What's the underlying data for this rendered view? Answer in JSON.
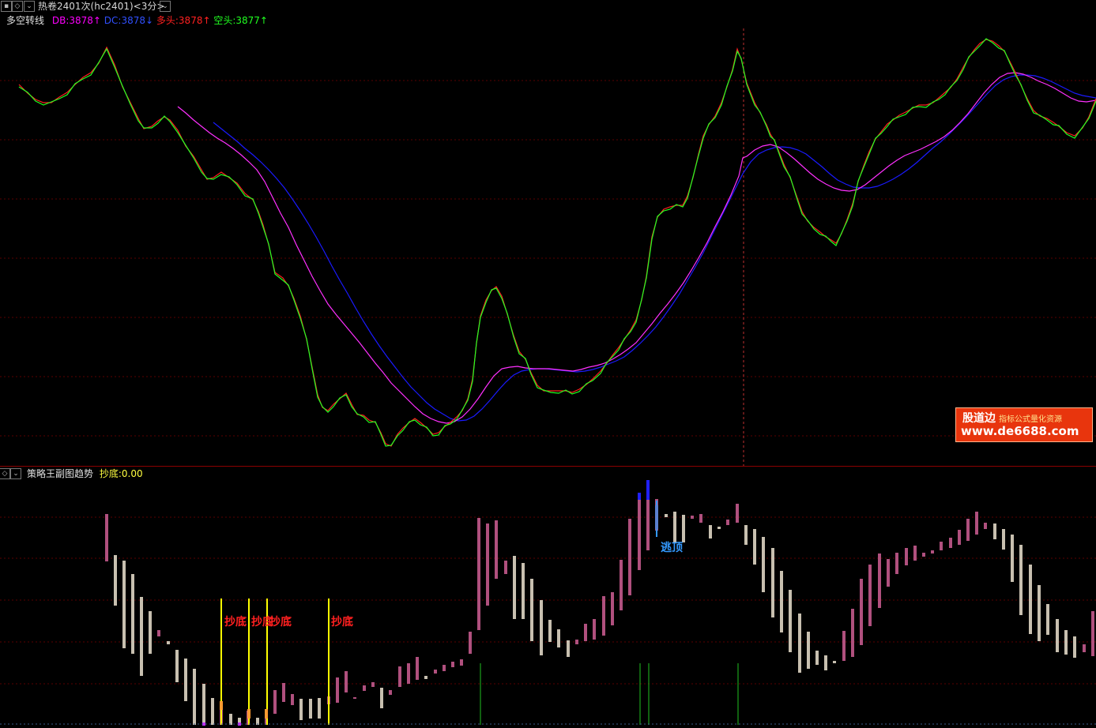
{
  "header": {
    "title": "热卷2401次(hc2401)<3分>"
  },
  "main_legend": {
    "name": "多空转线",
    "db": "DB:3878↑",
    "dc": "DC:3878↓",
    "duotou": "多头:3878↑",
    "kongtou": "空头:3877↑"
  },
  "sub_legend": {
    "name": "策略王副图趋势",
    "chaodi_value": "抄底:0.00"
  },
  "signals": {
    "chaodi_labels": [
      "抄底",
      "抄底",
      "抄底",
      "抄底"
    ],
    "taoding_label": "逃顶"
  },
  "watermark": {
    "brand": "股道边",
    "slogan": "指标公式量化资源",
    "url": "www.de6688.com"
  },
  "colors": {
    "background": "#000000",
    "db_line": "#ff00ff",
    "dc_line": "#0000ff",
    "duotou_line": "#ff2020",
    "kongtou_line": "#20ff20",
    "up_bar": "#b0507e",
    "down_bar": "#c8c0b0",
    "chaodi_signal": "#ffff00",
    "taoding_signal": "#3399ff",
    "grid": "#8b0000"
  }
}
